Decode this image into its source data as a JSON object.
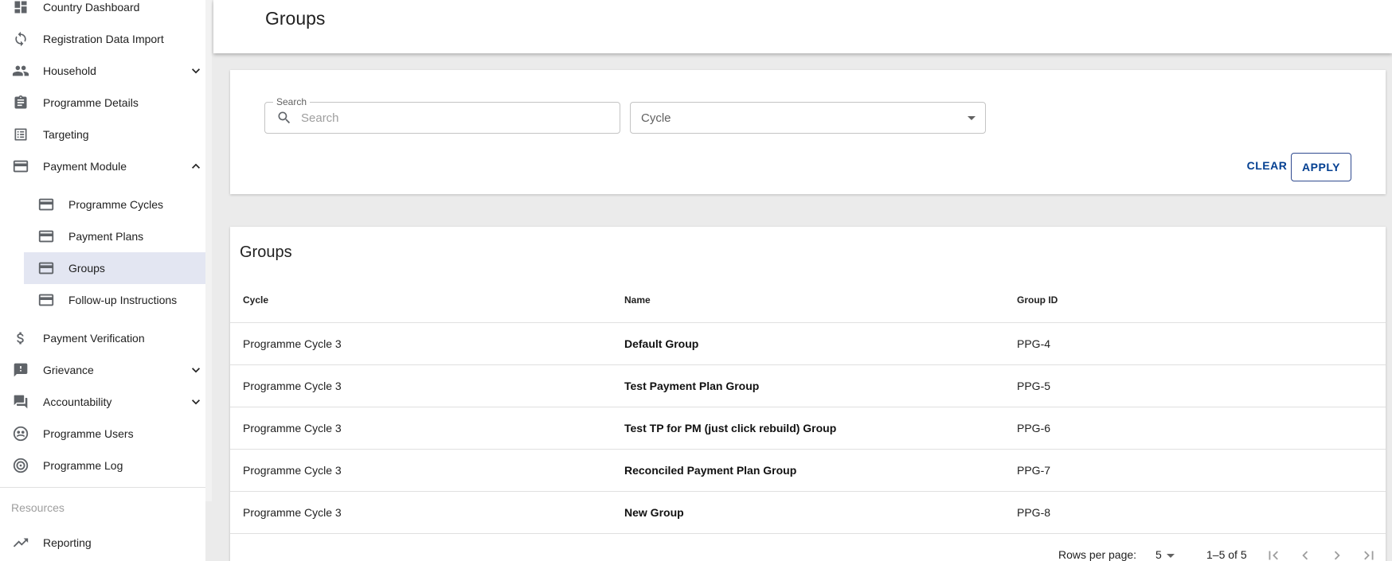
{
  "sidebar": {
    "items": [
      {
        "label": "Country Dashboard",
        "icon": "dashboard-icon"
      },
      {
        "label": "Registration Data Import",
        "icon": "refresh-icon"
      },
      {
        "label": "Household",
        "icon": "people-icon"
      },
      {
        "label": "Programme Details",
        "icon": "clipboard-icon"
      },
      {
        "label": "Targeting",
        "icon": "list-icon"
      },
      {
        "label": "Payment Module",
        "icon": "card-icon"
      },
      {
        "label": "Payment Verification",
        "icon": "dollar-icon"
      },
      {
        "label": "Grievance",
        "icon": "feedback-icon"
      },
      {
        "label": "Accountability",
        "icon": "forum-icon"
      },
      {
        "label": "Programme Users",
        "icon": "users-icon"
      },
      {
        "label": "Programme Log",
        "icon": "track-icon"
      }
    ],
    "payment_sub": [
      {
        "label": "Programme Cycles"
      },
      {
        "label": "Payment Plans"
      },
      {
        "label": "Groups"
      },
      {
        "label": "Follow-up Instructions"
      }
    ],
    "resources_label": "Resources",
    "reporting_label": "Reporting"
  },
  "header": {
    "title": "Groups"
  },
  "filters": {
    "search_legend": "Search",
    "search_placeholder": "Search",
    "cycle_value": "Cycle",
    "clear_label": "CLEAR",
    "apply_label": "APPLY"
  },
  "table": {
    "title": "Groups",
    "headers": {
      "cycle": "Cycle",
      "name": "Name",
      "group_id": "Group ID"
    },
    "rows": [
      {
        "cycle": "Programme Cycle 3",
        "name": "Default Group",
        "group_id": "PPG-4"
      },
      {
        "cycle": "Programme Cycle 3",
        "name": "Test Payment Plan Group",
        "group_id": "PPG-5"
      },
      {
        "cycle": "Programme Cycle 3",
        "name": "Test TP for PM (just click rebuild) Group",
        "group_id": "PPG-6"
      },
      {
        "cycle": "Programme Cycle 3",
        "name": "Reconciled Payment Plan Group",
        "group_id": "PPG-7"
      },
      {
        "cycle": "Programme Cycle 3",
        "name": "New Group",
        "group_id": "PPG-8"
      }
    ],
    "pagination": {
      "rows_per_page_label": "Rows per page:",
      "rows_per_page": "5",
      "range": "1–5 of 5"
    }
  },
  "colors": {
    "accent": "#033f91",
    "active_bg": "#e3e6f2"
  }
}
